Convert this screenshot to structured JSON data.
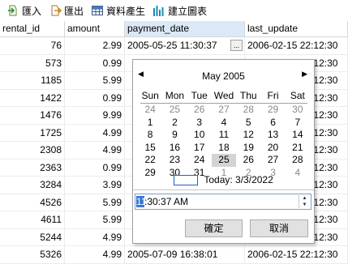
{
  "toolbar": {
    "import_label": "匯入",
    "export_label": "匯出",
    "generate_label": "資料產生",
    "chart_label": "建立圖表"
  },
  "columns": [
    "rental_id",
    "amount",
    "payment_date",
    "last_update"
  ],
  "rows": [
    [
      "76",
      "2.99",
      "2005-05-25 11:30:37",
      "2006-02-15 22:12:30"
    ],
    [
      "573",
      "0.99",
      "",
      "2006-02-15 22:12:30"
    ],
    [
      "1185",
      "5.99",
      "",
      "2006-02-15 22:12:30"
    ],
    [
      "1422",
      "0.99",
      "",
      "2006-02-15 22:12:30"
    ],
    [
      "1476",
      "9.99",
      "",
      "2006-02-15 22:12:30"
    ],
    [
      "1725",
      "4.99",
      "",
      "2006-02-15 22:12:30"
    ],
    [
      "2308",
      "4.99",
      "",
      "2006-02-15 22:12:30"
    ],
    [
      "2363",
      "0.99",
      "",
      "2006-02-15 22:12:30"
    ],
    [
      "3284",
      "3.99",
      "",
      "2006-02-15 22:12:30"
    ],
    [
      "4526",
      "5.99",
      "",
      "2006-02-15 22:12:30"
    ],
    [
      "4611",
      "5.99",
      "",
      "2006-02-15 22:12:30"
    ],
    [
      "5244",
      "4.99",
      "",
      "2006-02-15 22:12:30"
    ],
    [
      "5326",
      "4.99",
      "2005-07-09 16:38:01",
      "2006-02-15 22:12:30"
    ]
  ],
  "editor": {
    "ellipsis": "..."
  },
  "calendar": {
    "month_label": "May 2005",
    "prev_icon": "◀",
    "next_icon": "▶",
    "weekdays": [
      "Sun",
      "Mon",
      "Tue",
      "Wed",
      "Thu",
      "Fri",
      "Sat"
    ],
    "weeks": [
      [
        [
          "24",
          1
        ],
        [
          "25",
          1
        ],
        [
          "26",
          1
        ],
        [
          "27",
          1
        ],
        [
          "28",
          1
        ],
        [
          "29",
          1
        ],
        [
          "30",
          1
        ]
      ],
      [
        [
          "1",
          0
        ],
        [
          "2",
          0
        ],
        [
          "3",
          0
        ],
        [
          "4",
          0
        ],
        [
          "5",
          0
        ],
        [
          "6",
          0
        ],
        [
          "7",
          0
        ]
      ],
      [
        [
          "8",
          0
        ],
        [
          "9",
          0
        ],
        [
          "10",
          0
        ],
        [
          "11",
          0
        ],
        [
          "12",
          0
        ],
        [
          "13",
          0
        ],
        [
          "14",
          0
        ]
      ],
      [
        [
          "15",
          0
        ],
        [
          "16",
          0
        ],
        [
          "17",
          0
        ],
        [
          "18",
          0
        ],
        [
          "19",
          0
        ],
        [
          "20",
          0
        ],
        [
          "21",
          0
        ]
      ],
      [
        [
          "22",
          0
        ],
        [
          "23",
          0
        ],
        [
          "24",
          0
        ],
        [
          "25",
          2
        ],
        [
          "26",
          0
        ],
        [
          "27",
          0
        ],
        [
          "28",
          0
        ]
      ],
      [
        [
          "29",
          0
        ],
        [
          "30",
          0
        ],
        [
          "31",
          0
        ],
        [
          "1",
          1
        ],
        [
          "2",
          1
        ],
        [
          "3",
          1
        ],
        [
          "4",
          1
        ]
      ]
    ],
    "today_label": "Today: 3/3/2022"
  },
  "time": {
    "selected_part": "11",
    "rest": ":30:37 AM"
  },
  "buttons": {
    "ok": "確定",
    "cancel": "取消"
  }
}
